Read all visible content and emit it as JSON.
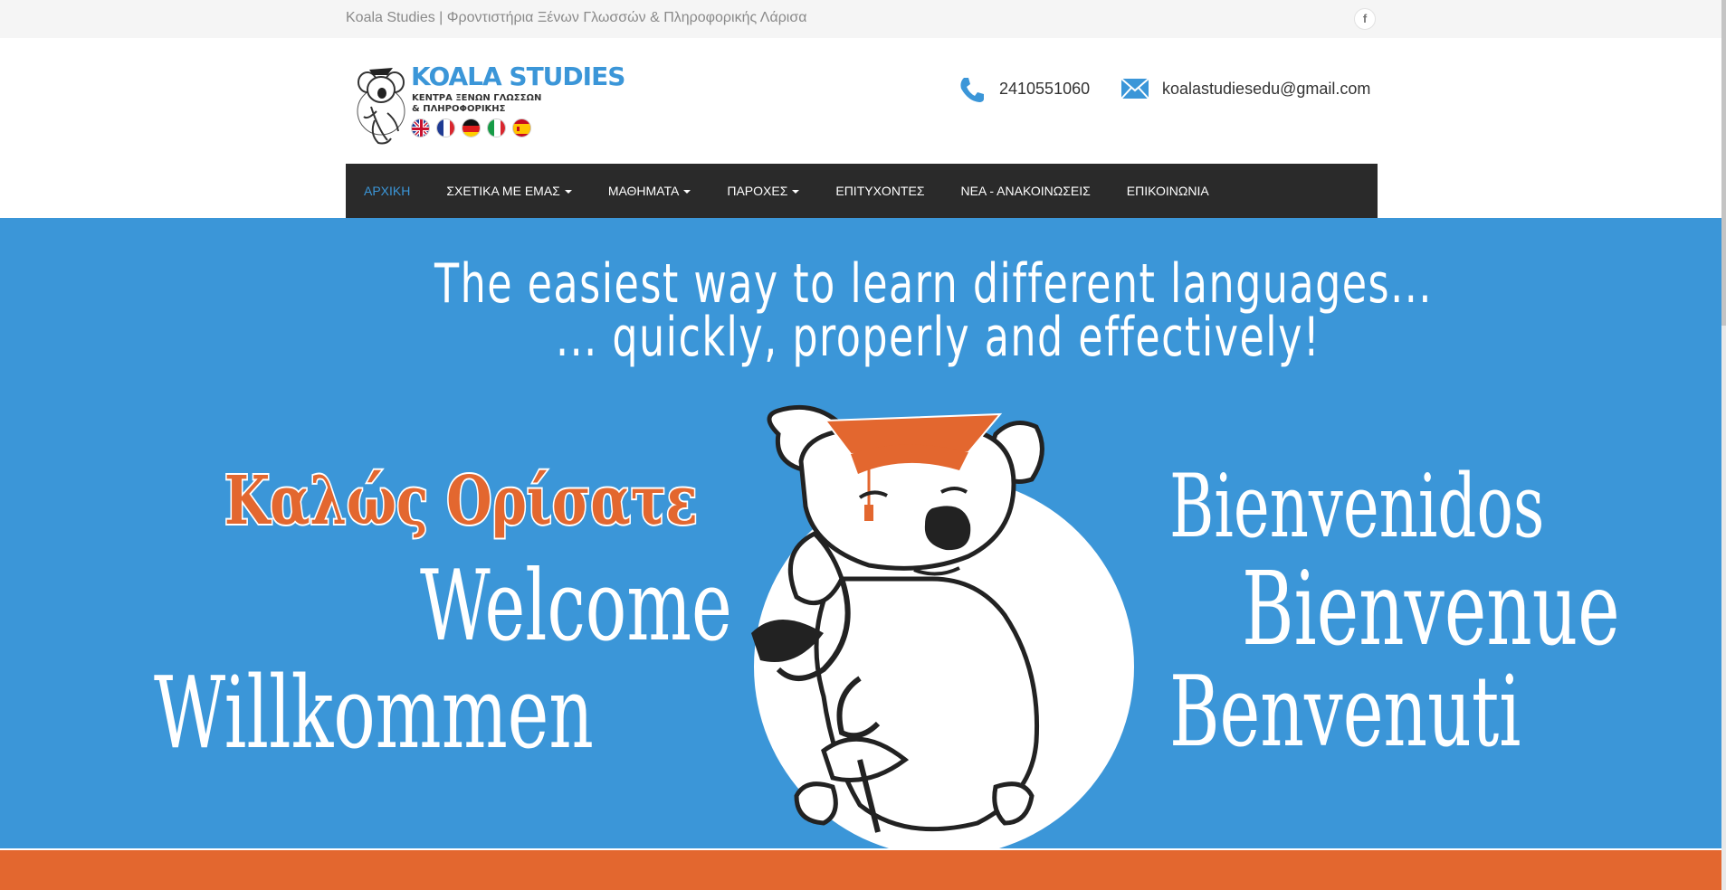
{
  "topbar": {
    "tagline": "Koala Studies | Φροντιστήρια Ξένων Γλωσσών & Πληροφορικής Λάρισα",
    "facebook_icon": "facebook-icon",
    "facebook_label": "f"
  },
  "header": {
    "logo_title": "KOALA STUDIES",
    "logo_subtitle_1": "ΚΕΝΤΡΑ ΞΕΝΩΝ ΓΛΩΣΣΩΝ",
    "logo_subtitle_2": "& ΠΛΗΡΟΦΟΡΙΚΗΣ",
    "flags": [
      "uk-flag-icon",
      "france-flag-icon",
      "germany-flag-icon",
      "italy-flag-icon",
      "spain-flag-icon"
    ],
    "phone": "2410551060",
    "email": "koalastudiesedu@gmail.com"
  },
  "nav": {
    "items": [
      {
        "label": "ΑΡΧΙΚΗ"
      },
      {
        "label": "ΣΧΕΤΙΚΑ ΜΕ ΕΜΑΣ"
      },
      {
        "label": "ΜΑΘΗΜΑΤΑ"
      },
      {
        "label": "ΠΑΡΟΧΕΣ"
      },
      {
        "label": "ΕΠΙΤΥΧΟΝΤΕΣ"
      },
      {
        "label": "ΝΕΑ - ΑΝΑΚΟΙΝΩΣΕΙΣ"
      },
      {
        "label": "ΕΠΙΚΟΙΝΩΝΙΑ"
      }
    ]
  },
  "hero": {
    "headline_1": "The easiest way to learn different languages...",
    "headline_2": "... quickly, properly and effectively!",
    "greeting_greek": "Καλώς Ορίσατε",
    "greeting_en": "Welcome",
    "greeting_de": "Willkommen",
    "greeting_es": "Bienvenidos",
    "greeting_fr": "Bienvenue",
    "greeting_it": "Benvenuti"
  },
  "colors": {
    "accent_blue": "#3b96d8",
    "accent_orange": "#e3672f",
    "nav_bg": "#2a2a2a"
  }
}
